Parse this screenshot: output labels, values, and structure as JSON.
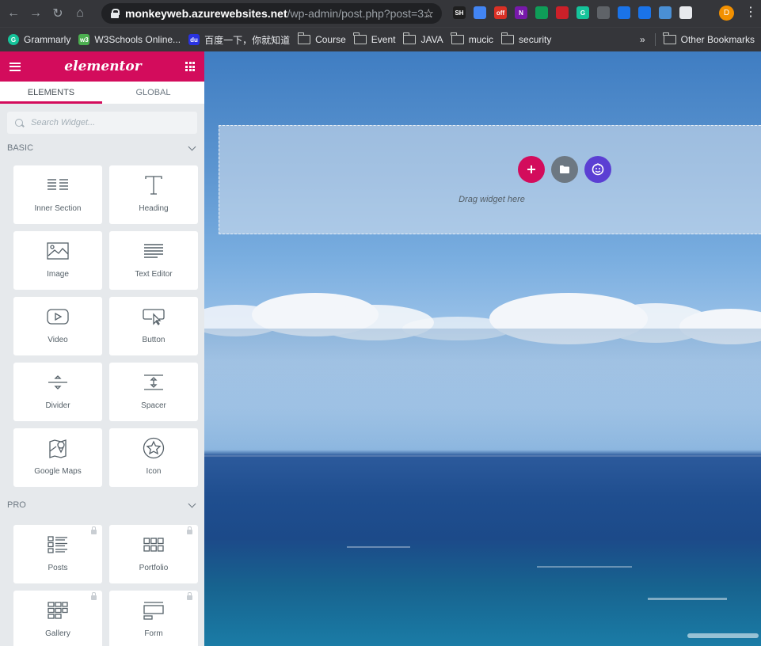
{
  "browser": {
    "url_domain": "monkeyweb.azurewebsites.net",
    "url_path": "/wp-admin/post.php?post=3...",
    "avatar_letter": "D",
    "extensions": [
      {
        "name": "session-buddy-extension",
        "text": "SH",
        "color": "#1f1f1f"
      },
      {
        "name": "kite-extension",
        "text": "",
        "color": "#4285f4"
      },
      {
        "name": "coupon-extension",
        "text": "off",
        "color": "#d93025"
      },
      {
        "name": "onenote-extension",
        "text": "N",
        "color": "#7719aa"
      },
      {
        "name": "drive-extension",
        "text": "",
        "color": "#0f9d58"
      },
      {
        "name": "lastpass-extension",
        "text": "",
        "color": "#cc2029"
      },
      {
        "name": "grammarly-extension",
        "text": "G",
        "color": "#15c39a"
      },
      {
        "name": "grey-extension",
        "text": "",
        "color": "#5f6368"
      },
      {
        "name": "screenshot-extension",
        "text": "",
        "color": "#1a73e8"
      },
      {
        "name": "crop-extension",
        "text": "",
        "color": "#1a73e8"
      },
      {
        "name": "image-extension",
        "text": "",
        "color": "#4a8fd4"
      },
      {
        "name": "puzzle-extension",
        "text": "",
        "color": "#e8eaed"
      }
    ]
  },
  "bookmarks": {
    "items": [
      {
        "label": "Grammarly",
        "icon": "grammarly-icon",
        "color": "#15c39a"
      },
      {
        "label": "W3Schools Online...",
        "icon": "w3schools-icon",
        "color": "#4caf50"
      },
      {
        "label": "百度一下，你就知道",
        "icon": "baidu-icon",
        "color": "#2932e1"
      },
      {
        "label": "Course",
        "icon": "folder-icon"
      },
      {
        "label": "Event",
        "icon": "folder-icon"
      },
      {
        "label": "JAVA",
        "icon": "folder-icon"
      },
      {
        "label": "mucic",
        "icon": "folder-icon"
      },
      {
        "label": "security",
        "icon": "folder-icon"
      }
    ],
    "overflow": "»",
    "other": "Other Bookmarks"
  },
  "panel": {
    "logo": "elementor",
    "tabs": [
      "ELEMENTS",
      "GLOBAL"
    ],
    "search_placeholder": "Search Widget...",
    "basic_title": "BASIC",
    "pro_title": "PRO",
    "basic_widgets": [
      {
        "label": "Inner Section",
        "icon": "inner-section-icon"
      },
      {
        "label": "Heading",
        "icon": "heading-icon"
      },
      {
        "label": "Image",
        "icon": "image-icon"
      },
      {
        "label": "Text Editor",
        "icon": "text-editor-icon"
      },
      {
        "label": "Video",
        "icon": "video-icon"
      },
      {
        "label": "Button",
        "icon": "button-icon"
      },
      {
        "label": "Divider",
        "icon": "divider-icon"
      },
      {
        "label": "Spacer",
        "icon": "spacer-icon"
      },
      {
        "label": "Google Maps",
        "icon": "google-maps-icon"
      },
      {
        "label": "Icon",
        "icon": "star-icon"
      }
    ],
    "pro_widgets": [
      {
        "label": "Posts",
        "icon": "posts-icon"
      },
      {
        "label": "Portfolio",
        "icon": "portfolio-icon"
      },
      {
        "label": "Gallery",
        "icon": "gallery-icon"
      },
      {
        "label": "Form",
        "icon": "form-icon"
      }
    ]
  },
  "canvas": {
    "drop_text": "Drag widget here",
    "colors": {
      "add": "#d30c5c",
      "template": "#6d7882",
      "kit": "#5b3fd3"
    }
  }
}
